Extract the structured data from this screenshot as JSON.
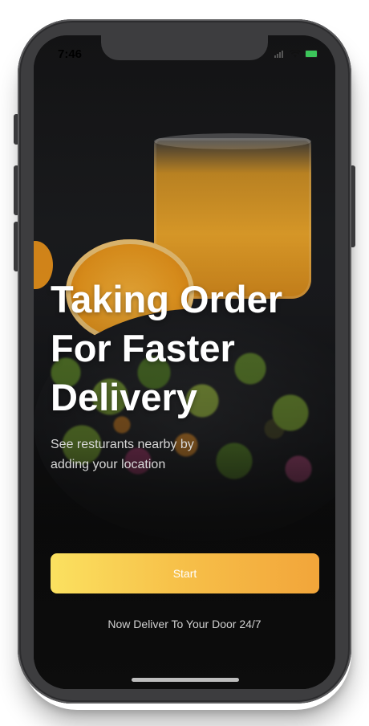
{
  "status_bar": {
    "time": "7:46",
    "icons": [
      "signal-icon",
      "wifi-icon",
      "battery-icon"
    ],
    "battery_color": "#3cc55a"
  },
  "hero": {
    "headline_lines": [
      "Taking Order",
      "For Faster",
      "Delivery"
    ],
    "subtitle_lines": [
      "See resturants nearby by",
      "adding your location"
    ]
  },
  "actions": {
    "start_label": "Start",
    "gradient_colors": [
      "#fbe160",
      "#f2a53a"
    ]
  },
  "footer": {
    "tagline": "Now Deliver To Your Door 24/7"
  }
}
